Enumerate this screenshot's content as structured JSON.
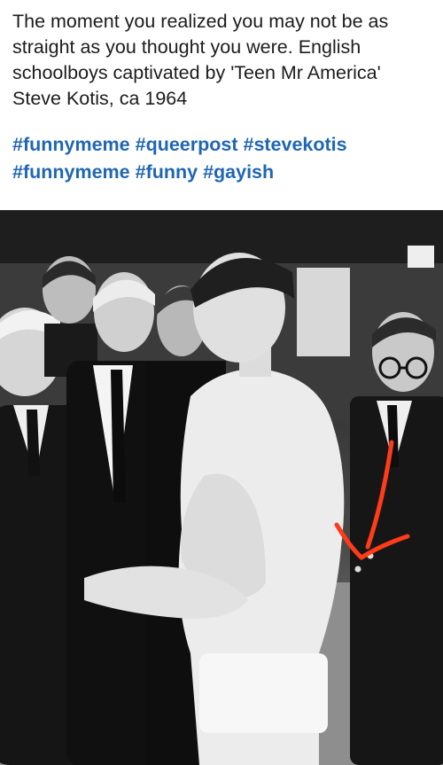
{
  "post": {
    "caption": "The moment you realized you may not be as straight as you thought you were. English schoolboys captivated by 'Teen Mr America' Steve Kotis, ca 1964",
    "hashtags": [
      "#funnymeme",
      "#queerpost",
      "#stevekotis",
      "#funnymeme",
      "#funny",
      "#gayish"
    ],
    "hashtag_color": "#1f66b5",
    "annotation_color": "#ff3b1a"
  }
}
